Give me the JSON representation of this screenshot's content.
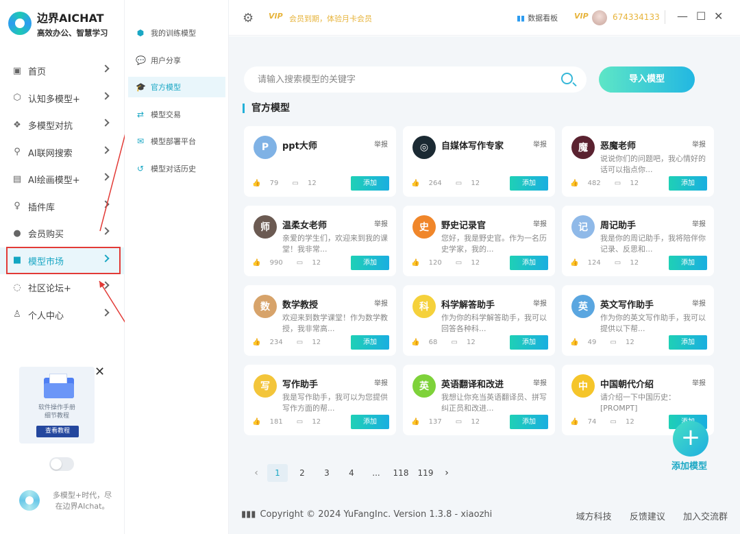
{
  "app": {
    "name": "边界AICHAT",
    "slogan": "高效办公、智慧学习"
  },
  "nav": [
    {
      "label": "首页",
      "icon": "home-icon"
    },
    {
      "label": "认知多模型+",
      "icon": "cube-icon"
    },
    {
      "label": "多模型对抗",
      "icon": "diamond-icon"
    },
    {
      "label": "AI联网搜索",
      "icon": "search-icon"
    },
    {
      "label": "AI绘画模型+",
      "icon": "image-icon"
    },
    {
      "label": "插件库",
      "icon": "bulb-icon"
    },
    {
      "label": "会员购买",
      "icon": "user-icon"
    },
    {
      "label": "模型市场",
      "icon": "market-icon",
      "active": true
    },
    {
      "label": "社区论坛+",
      "icon": "chat-icon"
    },
    {
      "label": "个人中心",
      "icon": "person-icon"
    }
  ],
  "submenu": [
    {
      "label": "我的训练模型",
      "icon": "cube-icon"
    },
    {
      "label": "用户分享",
      "icon": "chat-bubble-icon"
    },
    {
      "label": "官方模型",
      "icon": "graduation-cap-icon",
      "active": true
    },
    {
      "label": "模型交易",
      "icon": "trade-icon"
    },
    {
      "label": "模型部署平台",
      "icon": "mail-icon"
    },
    {
      "label": "模型对话历史",
      "icon": "history-icon"
    }
  ],
  "promo": {
    "line1": "软件操作手册",
    "line2": "细节教程",
    "button": "查看教程"
  },
  "footer_slogan": {
    "line1": "多模型+时代，尽",
    "line2": "在边界AIchat。"
  },
  "topbar": {
    "vip_promo": "会员到期，体验月卡会员",
    "vip_badge": "VIP",
    "dashboard": "数据看板",
    "user_id": "674334133"
  },
  "search": {
    "placeholder": "请输入搜索模型的关键字"
  },
  "import_button": "导入模型",
  "section_title": "官方模型",
  "report_label": "举报",
  "add_label": "添加",
  "cards": [
    {
      "name": "ppt大师",
      "desc": "",
      "likes": "79",
      "comments": "12",
      "avatar_color": "#7fb2e5",
      "avatar_char": "P"
    },
    {
      "name": "自媒体写作专家",
      "desc": "",
      "likes": "264",
      "comments": "12",
      "avatar_color": "#1b2a33",
      "avatar_char": "◎"
    },
    {
      "name": "恶魔老师",
      "desc": "说说你们的问题吧，我心情好的话可以指点你...",
      "likes": "482",
      "comments": "12",
      "avatar_color": "#5a2230",
      "avatar_char": "魔"
    },
    {
      "name": "温柔女老师",
      "desc": "亲爱的学生们，欢迎来到我的课堂！我非常...",
      "likes": "990",
      "comments": "12",
      "avatar_color": "#6b5a52",
      "avatar_char": "师"
    },
    {
      "name": "野史记录官",
      "desc": "您好，我是野史官。作为一名历史学家，我的...",
      "likes": "120",
      "comments": "12",
      "avatar_color": "#f0862a",
      "avatar_char": "史"
    },
    {
      "name": "周记助手",
      "desc": "我是你的周记助手，我将陪伴你记录、反思和...",
      "likes": "124",
      "comments": "12",
      "avatar_color": "#8fb9e8",
      "avatar_char": "记"
    },
    {
      "name": "数学教授",
      "desc": "欢迎来到数学课堂！作为数学教授，我非常高...",
      "likes": "234",
      "comments": "12",
      "avatar_color": "#d7a36a",
      "avatar_char": "数"
    },
    {
      "name": "科学解答助手",
      "desc": "作为你的科学解答助手，我可以回答各种科...",
      "likes": "68",
      "comments": "12",
      "avatar_color": "#f5d13b",
      "avatar_char": "科"
    },
    {
      "name": "英文写作助手",
      "desc": "作为你的英文写作助手，我可以提供以下帮...",
      "likes": "49",
      "comments": "12",
      "avatar_color": "#5aa6e0",
      "avatar_char": "英"
    },
    {
      "name": "写作助手",
      "desc": "我是写作助手，我可以为您提供写作方面的帮...",
      "likes": "181",
      "comments": "12",
      "avatar_color": "#f3c53a",
      "avatar_char": "写"
    },
    {
      "name": "英语翻译和改进",
      "desc": "我想让你充当英语翻译员、拼写纠正员和改进...",
      "likes": "137",
      "comments": "12",
      "avatar_color": "#7ed23a",
      "avatar_char": "英"
    },
    {
      "name": "中国朝代介绍",
      "desc": "请介绍一下中国历史：[PROMPT]",
      "likes": "74",
      "comments": "12",
      "avatar_color": "#f5c52a",
      "avatar_char": "中"
    }
  ],
  "pagination": {
    "pages": [
      "1",
      "2",
      "3",
      "4",
      "...",
      "118",
      "119"
    ],
    "current": "1"
  },
  "fab_label": "添加模型",
  "footer": {
    "copyright": "Copyright © 2024 YuFangInc. Version 1.3.8 - xiaozhi",
    "links": [
      "域方科技",
      "反馈建议",
      "加入交流群"
    ]
  },
  "colors": {
    "accent": "#1aa7c4",
    "highlight": "#e23a36",
    "vip": "#e7b43c"
  }
}
